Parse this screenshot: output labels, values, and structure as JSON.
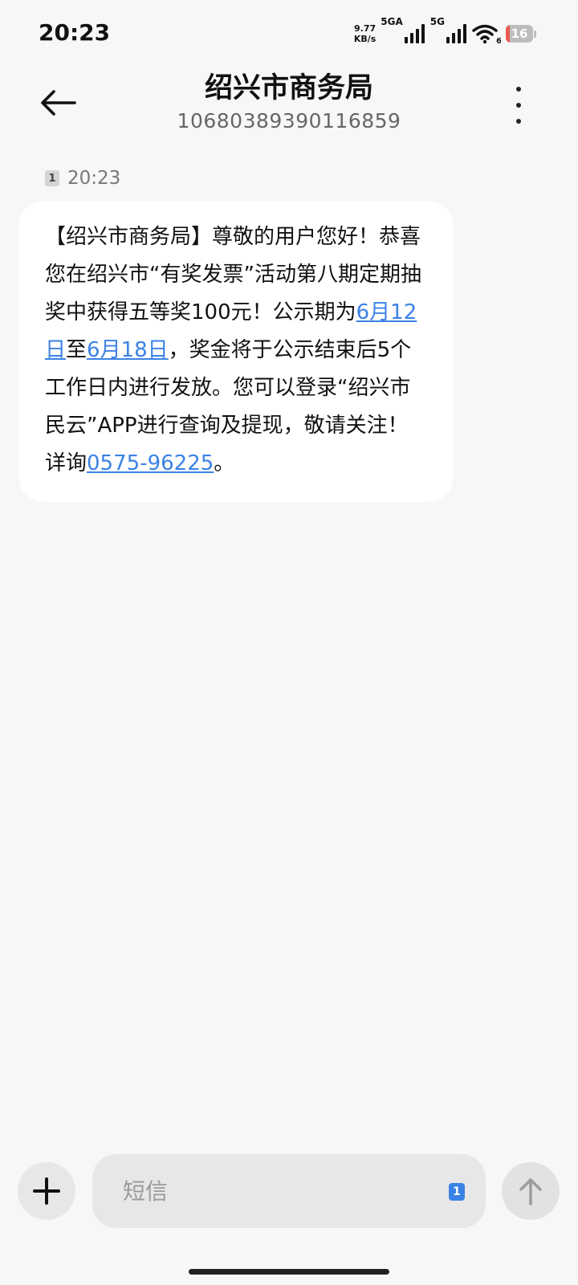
{
  "status_bar": {
    "time": "20:23",
    "net_speed_value": "9.77",
    "net_speed_unit": "KB/s",
    "sim1_network": "5GA",
    "sim2_network": "5G",
    "wifi_badge": "6",
    "battery_level": "16",
    "battery_fraction": 0.16,
    "battery_color": "#e85a4f"
  },
  "header": {
    "contact_name": "绍兴市商务局",
    "contact_number": "10680389390116859",
    "back_icon": "arrow-left-icon",
    "more_icon": "more-vertical-icon"
  },
  "message": {
    "sim_slot": "1",
    "time": "20:23",
    "text_part1": "【绍兴市商务局】尊敬的用户您好！恭喜您在绍兴市“有奖发票”活动第八期定期抽奖中获得五等奖100元！公示期为",
    "link_date1": "6月12日",
    "text_part2": "至",
    "link_date2": "6月18日",
    "text_part3": "，奖金将于公示结束后5个工作日内进行发放。您可以登录“绍兴市民云”APP进行查询及提现，敬请关注！详询",
    "link_phone": "0575-96225",
    "text_part4": "。",
    "link_color": "#3b82e6"
  },
  "composer": {
    "placeholder": "短信",
    "sim_slot": "1",
    "add_icon": "plus-icon",
    "send_icon": "arrow-up-icon"
  }
}
